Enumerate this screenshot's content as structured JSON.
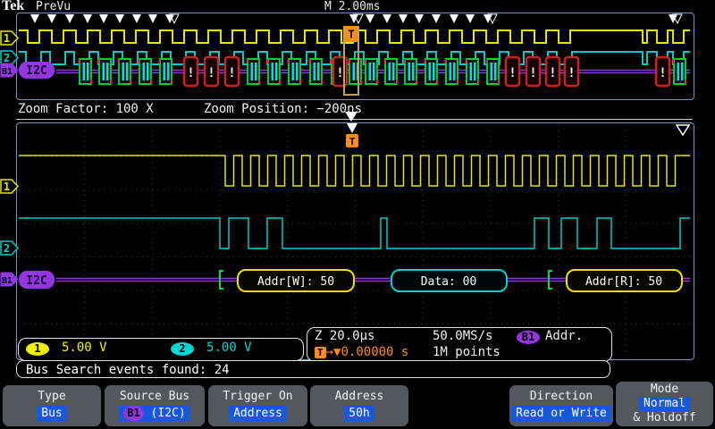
{
  "header": {
    "logo": "Tek",
    "mode": "PreVu",
    "time_base": "M 2.00ms"
  },
  "zoom_bar": {
    "factor": "Zoom Factor: 100 X",
    "position": "Zoom Position: −200ns"
  },
  "overview": {
    "ch1_badge": "1",
    "ch2_badge": "2",
    "bus_badge": "B1",
    "bus_label": "I2C",
    "trigger_flag": "T",
    "error_glyph": "!"
  },
  "zoom_window": {
    "ch1_badge": "1",
    "ch2_badge": "2",
    "bus_badge": "B1",
    "bus_label": "I2C",
    "trigger_flag": "T",
    "packets": [
      {
        "label": "Addr[W]: 50",
        "color": "#f0e000"
      },
      {
        "label": "Data: 00",
        "color": "#00d0d0"
      },
      {
        "label": "Addr[R]: 50",
        "color": "#f0e000"
      }
    ]
  },
  "readouts": {
    "ch1_badge": "1",
    "ch1_scale": "5.00 V",
    "ch2_badge": "2",
    "ch2_scale": "5.00 V",
    "zoom_scale": "Z 20.0µs",
    "sample_rate": "50.0MS/s",
    "bus_badge": "B1",
    "bus_trigger": "Addr.",
    "trigger_flag": "T",
    "trigger_time": "0.00000 s",
    "record_length": "1M points"
  },
  "search_bar": {
    "text": "Bus Search events found: 24"
  },
  "menu": {
    "type": {
      "label": "Type",
      "value": "Bus"
    },
    "source_bus": {
      "label": "Source Bus",
      "badge": "B1",
      "value": "(I2C)"
    },
    "trigger_on": {
      "label": "Trigger On",
      "value": "Address"
    },
    "address": {
      "label": "Address",
      "value": "50h"
    },
    "direction": {
      "label": "Direction",
      "value": "Read or Write"
    },
    "mode": {
      "label": "Mode",
      "value": "Normal",
      "value2": "& Holdoff"
    }
  },
  "colors": {
    "ch1": "#e6e600",
    "ch2": "#00cccc",
    "bus": "#9136e0",
    "trigger_orange": "#ff8c1a",
    "value_blue": "#1659e0",
    "decode_error": "#cc2222",
    "decode_ok": "#00cc33"
  }
}
